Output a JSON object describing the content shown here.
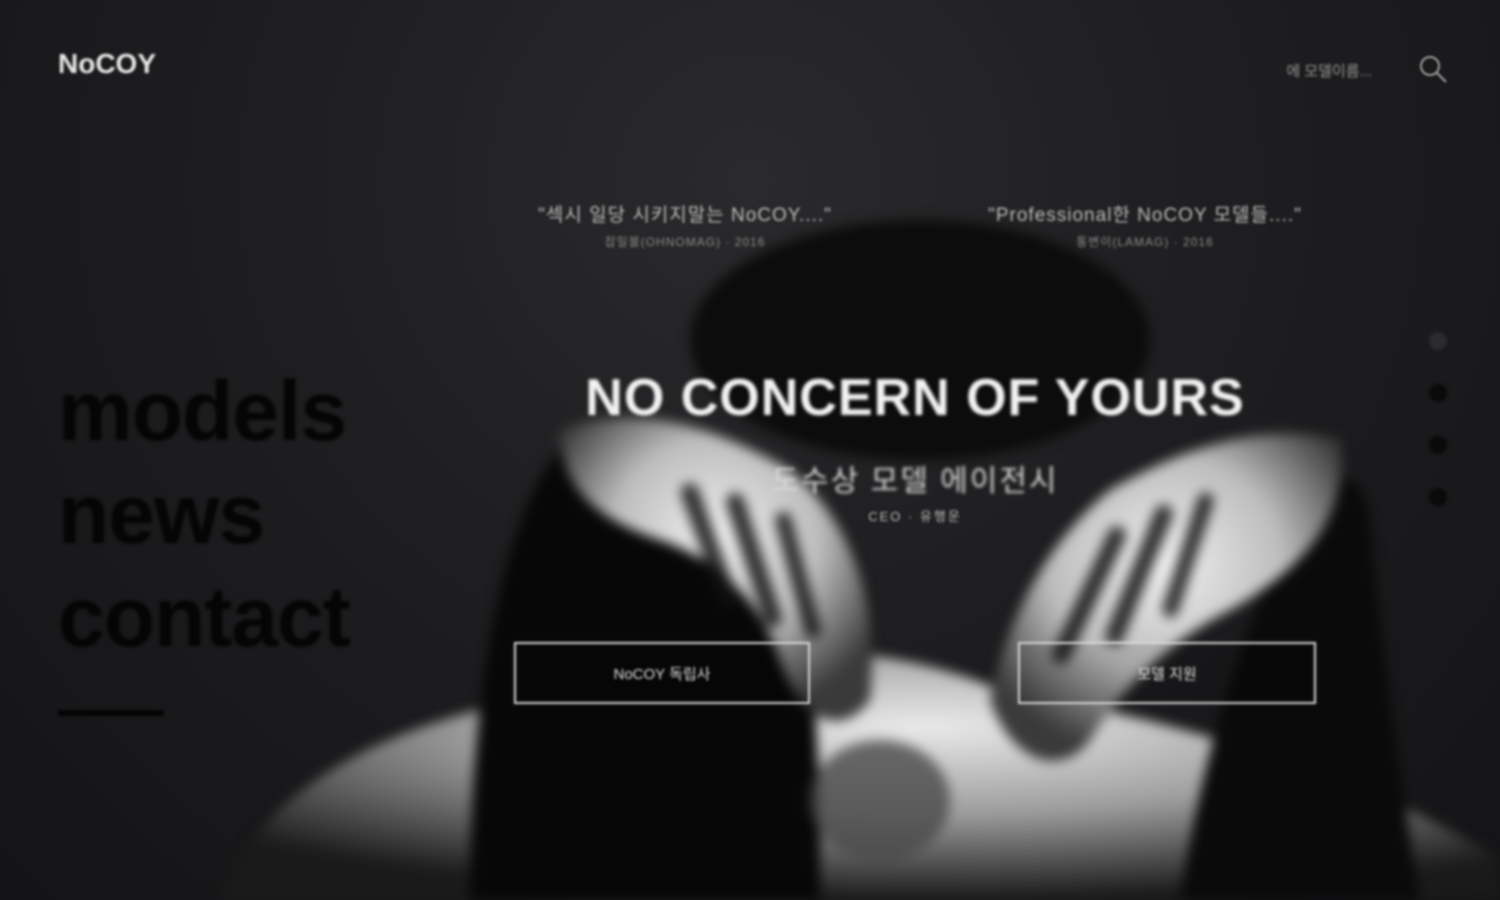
{
  "header": {
    "logo": "NoCOY",
    "search_hint": "에 모델이름...",
    "search_icon": "search-icon"
  },
  "quotes": [
    {
      "text": "\"섹시 일당 시키지말는 NoCOY....\"",
      "source": "잡일불(OHNOMAG) · 2016"
    },
    {
      "text": "\"Professional한 NoCOY 모델들....\"",
      "source": "통변이(LAMAG) · 2016"
    }
  ],
  "nav": {
    "items": [
      "models",
      "news",
      "contact"
    ]
  },
  "hero": {
    "headline": "NO CONCERN OF YOURS",
    "subline": "도수상 모델 에이전시",
    "subline_small": "CEO · 유행운",
    "cta_left": "NoCOY 독립사",
    "cta_right": "모델 지원"
  },
  "slider": {
    "dot_count": 4,
    "active_index": 1
  },
  "colors": {
    "background": "#1c1c1e",
    "nav_text": "#050505",
    "headline": "#f2f2f2"
  }
}
